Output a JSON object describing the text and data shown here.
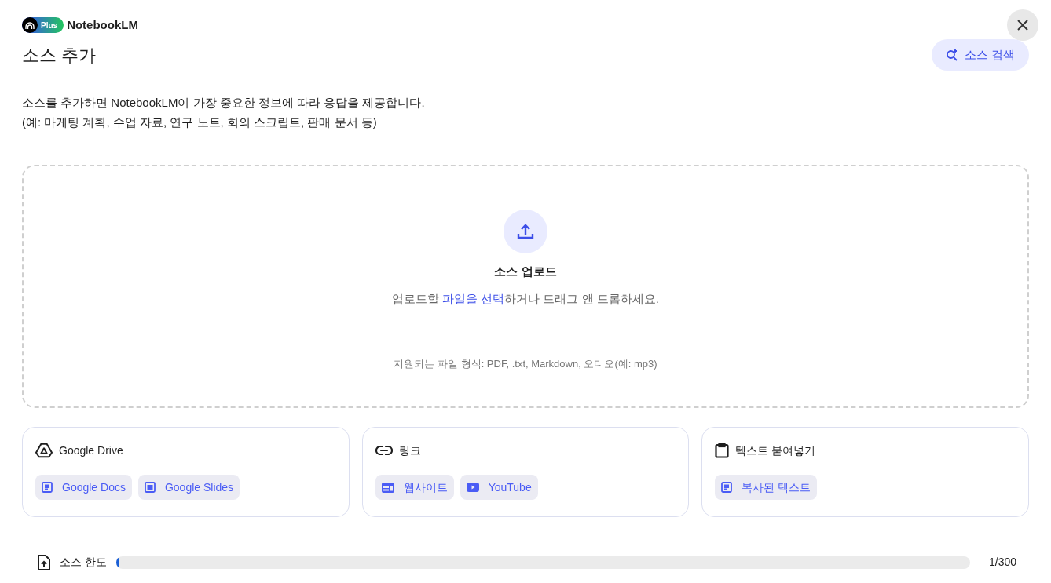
{
  "header": {
    "badge": "Plus",
    "brand": "NotebookLM"
  },
  "title": "소스 추가",
  "search_button": "소스 검색",
  "description": [
    "소스를 추가하면 NotebookLM이 가장 중요한 정보에 따라 응답을 제공합니다.",
    "(예: 마케팅 계획, 수업 자료, 연구 노트, 회의 스크립트, 판매 문서 등)"
  ],
  "upload": {
    "title": "소스 업로드",
    "before": "업로드할 ",
    "link": "파일을 선택",
    "after": "하거나 드래그 앤 드롭하세요.",
    "formats": "지원되는 파일 형식: PDF, .txt, Markdown, 오디오(예: mp3)"
  },
  "cards": [
    {
      "kind": "drive",
      "title": "Google Drive",
      "chips": [
        {
          "kind": "doc",
          "label": "Google Docs"
        },
        {
          "kind": "slides",
          "label": "Google Slides"
        }
      ]
    },
    {
      "kind": "link",
      "title": "링크",
      "chips": [
        {
          "kind": "website",
          "label": "웹사이트"
        },
        {
          "kind": "youtube",
          "label": "YouTube"
        }
      ]
    },
    {
      "kind": "paste",
      "title": "텍스트 붙여넣기",
      "chips": [
        {
          "kind": "doc",
          "label": "복사된 텍스트"
        }
      ]
    }
  ],
  "limit": {
    "label": "소스 한도",
    "level": 0.0033,
    "reading": "1/300"
  }
}
